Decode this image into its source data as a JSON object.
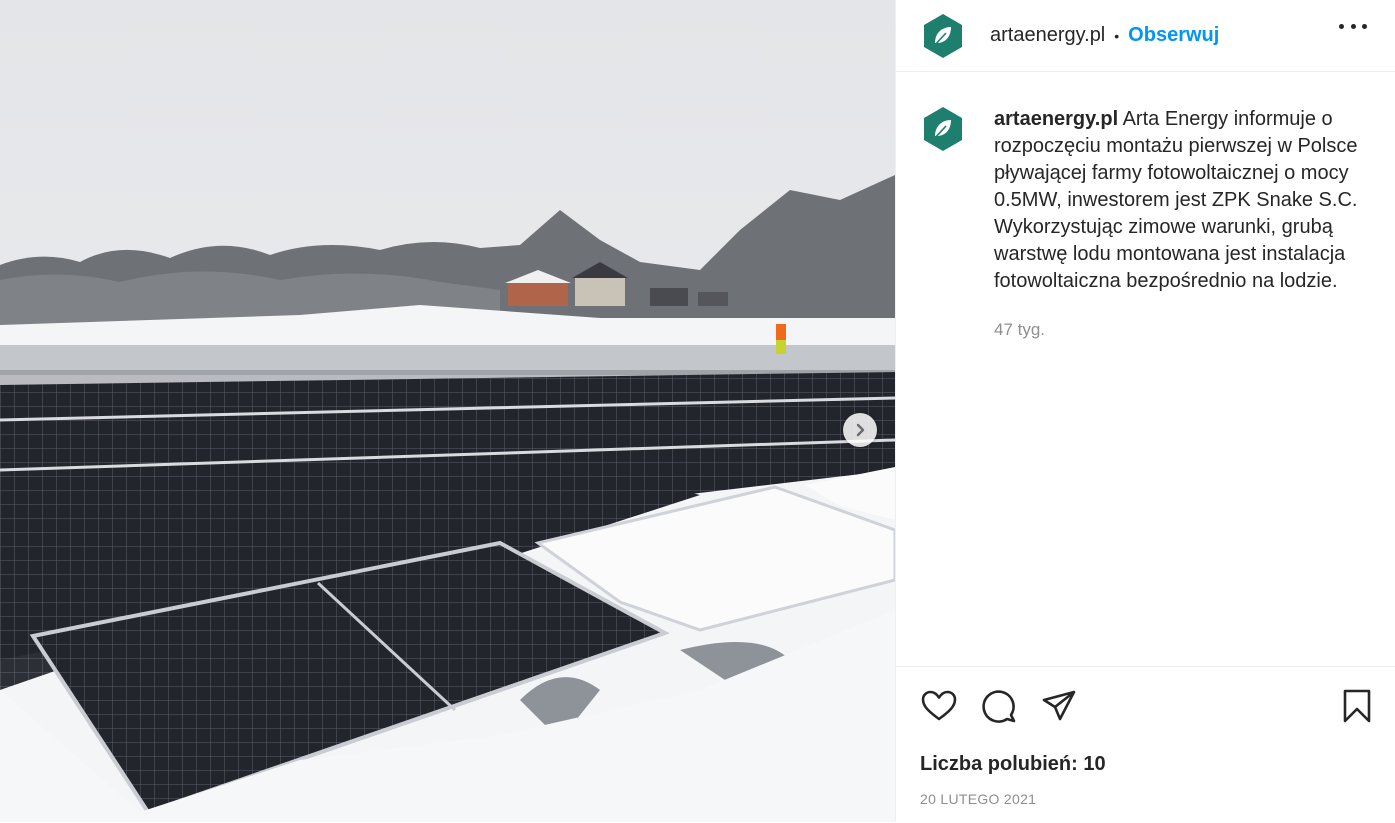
{
  "post": {
    "username": "artaenergy.pl",
    "separator": "•",
    "follow_label": "Obserwuj",
    "more_label": "more-options",
    "caption_user": "artaenergy.pl",
    "caption_text": "Arta Energy informuje o rozpoczęciu montażu pierwszej w Polsce pływającej farmy fotowoltaicznej o mocy 0.5MW, inwestorem jest ZPK Snake S.C. Wykorzystując zimowe warunki, grubą warstwę lodu montowana jest instalacja fotowoltaiczna bezpośrednio na lodzie.",
    "time_ago": "47 tyg.",
    "likes": "Liczba polubień: 10",
    "date": "20 LUTEGO 2021"
  },
  "icons": {
    "like": "heart-icon",
    "comment": "comment-icon",
    "share": "paper-plane-icon",
    "save": "bookmark-icon",
    "next": "chevron-right-icon"
  },
  "colors": {
    "accent": "#0095f6",
    "avatar_bg": "#1e7f6e",
    "text": "#262626",
    "muted": "#8e8e8e"
  }
}
